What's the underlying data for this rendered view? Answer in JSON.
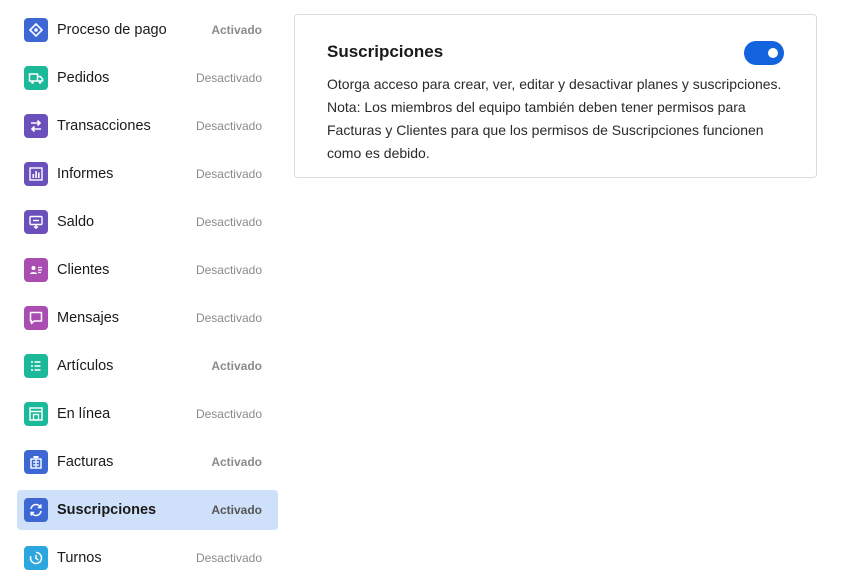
{
  "sidebar": {
    "items": [
      {
        "label": "Proceso de pago",
        "status": "Activado",
        "icon": "checkout-icon",
        "color": "#3d68d4"
      },
      {
        "label": "Pedidos",
        "status": "Desactivado",
        "icon": "truck-icon",
        "color": "#1bb99a"
      },
      {
        "label": "Transacciones",
        "status": "Desactivado",
        "icon": "swap-arrows-icon",
        "color": "#6b4fbb"
      },
      {
        "label": "Informes",
        "status": "Desactivado",
        "icon": "bar-chart-icon",
        "color": "#6b4fbb"
      },
      {
        "label": "Saldo",
        "status": "Desactivado",
        "icon": "balance-icon",
        "color": "#6b4fbb"
      },
      {
        "label": "Clientes",
        "status": "Desactivado",
        "icon": "customer-card-icon",
        "color": "#a94db1"
      },
      {
        "label": "Mensajes",
        "status": "Desactivado",
        "icon": "message-icon",
        "color": "#a94db1"
      },
      {
        "label": "Artículos",
        "status": "Activado",
        "icon": "list-icon",
        "color": "#1bb99a"
      },
      {
        "label": "En línea",
        "status": "Desactivado",
        "icon": "storefront-icon",
        "color": "#1bb99a"
      },
      {
        "label": "Facturas",
        "status": "Activado",
        "icon": "invoice-icon",
        "color": "#3d68d4"
      },
      {
        "label": "Suscripciones",
        "status": "Activado",
        "icon": "refresh-icon",
        "color": "#3d68d4",
        "selected": true
      },
      {
        "label": "Turnos",
        "status": "Desactivado",
        "icon": "clock-icon",
        "color": "#2ba6de"
      }
    ]
  },
  "detail": {
    "title": "Suscripciones",
    "toggle_on": true,
    "description": "Otorga acceso para crear, ver, editar y desactivar planes y suscripciones. Nota: Los miembros del equipo también deben tener permisos para Facturas y Clientes para que los permisos de Suscripciones funcionen como es debido."
  },
  "colors": {
    "accent": "#1363de",
    "selected_bg": "#cfe0fb"
  }
}
